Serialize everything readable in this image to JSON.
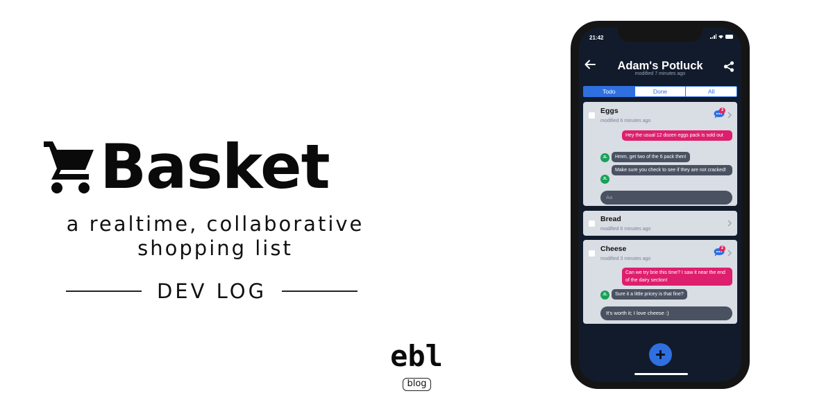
{
  "brand": {
    "name": "Basket",
    "icon": "shopping-cart-icon"
  },
  "tagline": {
    "line1": "a realtime, collaborative",
    "line2": "shopping list"
  },
  "devlog": "DEV LOG",
  "ebl": {
    "logo": "ebl",
    "badge": "blog"
  },
  "phone": {
    "status_time": "21:42",
    "list": {
      "title": "Adam's Potluck",
      "modified": "modified 7 minutes ago"
    },
    "tabs": [
      {
        "label": "Todo",
        "active": true
      },
      {
        "label": "Done",
        "active": false
      },
      {
        "label": "All",
        "active": false
      }
    ],
    "items": [
      {
        "name": "Eggs",
        "modified": "modified 6 minutes ago",
        "comment_count": "3",
        "messages": [
          {
            "text": "Hey the usual 12 dozen eggs pack is sold out",
            "own": true
          },
          {
            "text": "Hmm, get two of the 6 pack then!",
            "own": false,
            "avatar": "JL"
          },
          {
            "text": "Make sure you check to see if they are not cracked!",
            "own": false,
            "avatar": "JL"
          }
        ],
        "input_placeholder": "Aa"
      },
      {
        "name": "Bread",
        "modified": "modified 6 minutes ago"
      },
      {
        "name": "Cheese",
        "modified": "modified 3 minutes ago",
        "comment_count": "2",
        "messages": [
          {
            "text": "Can we try brie this time? I saw it near the end of the dairy section!",
            "own": true
          },
          {
            "text": "Sure it a little pricey is that fine?",
            "own": false,
            "avatar": "JL"
          }
        ],
        "input_value": "It's worth it; I love cheese :)"
      }
    ]
  },
  "colors": {
    "accent": "#2f6fe0",
    "own_message": "#dd1f6d",
    "other_message": "#4a5262",
    "avatar": "#17a158",
    "screen_bg": "#111b2b",
    "card_bg": "#d9dde4"
  }
}
